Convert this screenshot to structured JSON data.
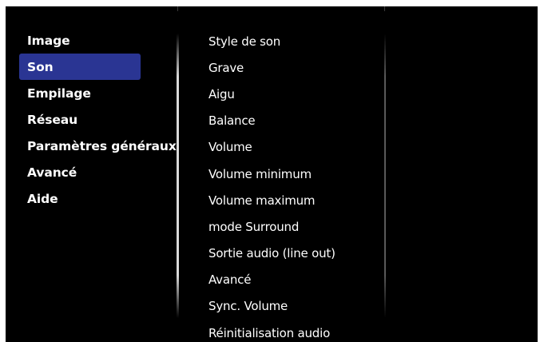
{
  "left_menu": {
    "items": [
      {
        "label": "Image",
        "selected": false
      },
      {
        "label": "Son",
        "selected": true
      },
      {
        "label": "Empilage",
        "selected": false
      },
      {
        "label": "Réseau",
        "selected": false
      },
      {
        "label": "Paramètres généraux",
        "selected": false
      },
      {
        "label": "Avancé",
        "selected": false
      },
      {
        "label": "Aide",
        "selected": false
      }
    ]
  },
  "submenu": {
    "items": [
      {
        "label": "Style de son"
      },
      {
        "label": "Grave"
      },
      {
        "label": "Aigu"
      },
      {
        "label": "Balance"
      },
      {
        "label": "Volume"
      },
      {
        "label": "Volume minimum"
      },
      {
        "label": "Volume maximum"
      },
      {
        "label": "mode Surround"
      },
      {
        "label": "Sortie audio (line out)"
      },
      {
        "label": "Avancé"
      },
      {
        "label": "Sync. Volume"
      },
      {
        "label": "Réinitialisation audio"
      }
    ]
  },
  "colors": {
    "background": "#000000",
    "selection": "#2a3593",
    "text": "#ffffff"
  }
}
